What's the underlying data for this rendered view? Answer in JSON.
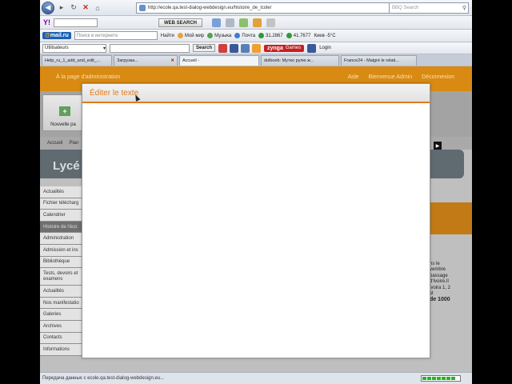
{
  "browser": {
    "url": "http://ecole.qa.test-dialog-webdesign.eu/histoire_de_lcole/",
    "search_placeholder": "BBQ Search",
    "nav_icons": [
      "back-icon",
      "forward-icon",
      "reload-icon",
      "stop-icon",
      "home-icon"
    ]
  },
  "toolbar1": {
    "brand": "Y!",
    "websearch_label": "WEB SEARCH"
  },
  "toolbar2": {
    "mailru_prefix": "@",
    "mailru_label": "mail.ru",
    "search_placeholder": "Поиск в интернете",
    "find_label": "Найти",
    "items": [
      "Мой мир",
      "Музыка",
      "Почта",
      "31.2867",
      "41.7677",
      "Киев -5°C"
    ]
  },
  "toolbar3": {
    "user_select": "Utilisateurs",
    "search_button": "Search",
    "zynga_label": "zynga",
    "zynga_games": "Games",
    "login": "Login"
  },
  "tabs": [
    {
      "label": "Help_ru_1_add_and_edit_..."
    },
    {
      "label": "Загрузка..."
    },
    {
      "label": "Accueil -"
    },
    {
      "label": "dolboeb: Мутко рулю ж..."
    },
    {
      "label": "France24 - Malgré le relati..."
    }
  ],
  "page": {
    "admin_link": "À la page d'administration",
    "help": "Aide",
    "welcome": "Bienvenue Admin",
    "logout": "Déconnexion",
    "new_page": "Nouvelle pa",
    "crumbs": [
      "Accueil",
      "Plan"
    ],
    "banner_title": "Lycé",
    "nav_items": [
      "Actualités",
      "Fichier télécharg",
      "Calendrier",
      "Histoire de l'éco",
      "Administration",
      "Admission et ins",
      "Bibliothèque",
      "Tests, devoirs et examens",
      "Actualités",
      "Nos manifestatio",
      "Galeries",
      "Archives",
      "Contacts",
      "Informations"
    ],
    "right_text": [
      "ns le",
      "vembre",
      "passage",
      "d'Ivoire.Il",
      "ivoira 1, 2",
      "st"
    ],
    "right_big": "de 1000"
  },
  "dialog": {
    "title": "Éditer le texte"
  },
  "status": {
    "text": "Передача данных с ecole.qa.test-dialog-webdesign.eu...",
    "progress_segments": 7,
    "progress_fraction": 0.78
  }
}
